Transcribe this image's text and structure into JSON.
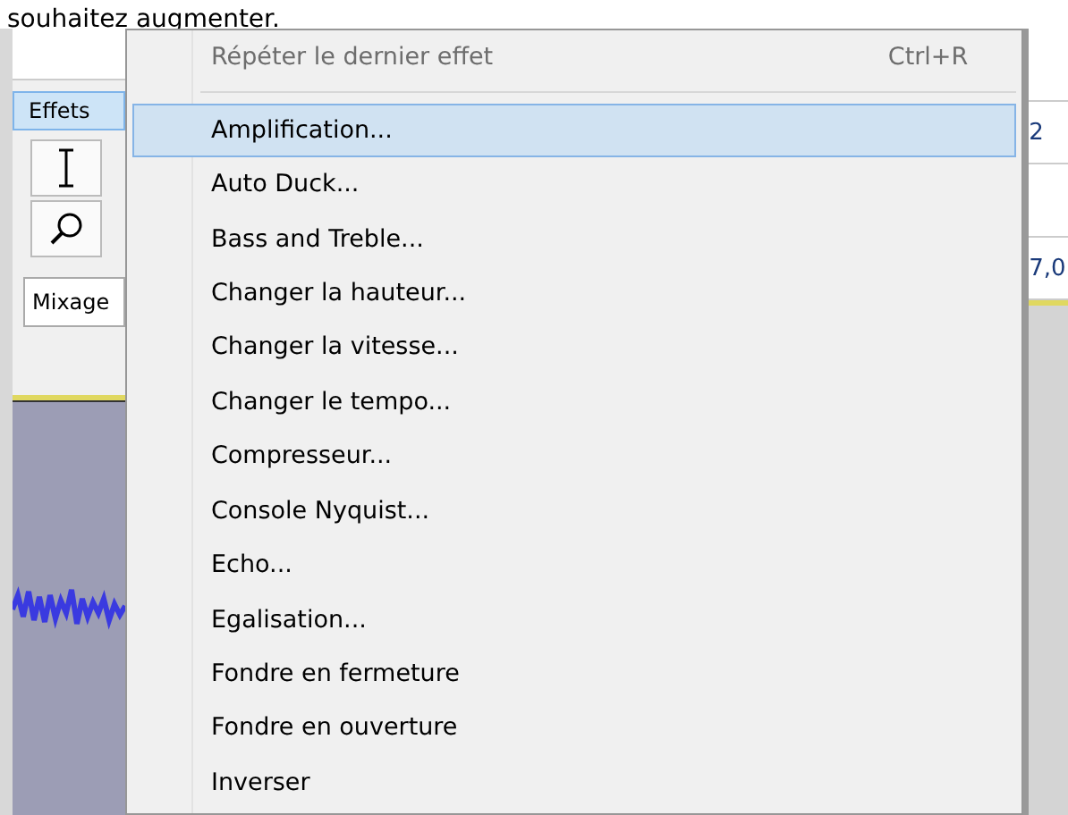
{
  "header_text": "souhaitez augmenter.",
  "app": {
    "menu_label": "Effets",
    "menu_open": true,
    "mix_dropdown": "Mixage",
    "right_labels": [
      "2",
      "7,0"
    ]
  },
  "menu": {
    "items": [
      {
        "kind": "item",
        "label": "Répéter le dernier effet",
        "shortcut": "Ctrl+R",
        "disabled": true,
        "selected": false
      },
      {
        "kind": "separator"
      },
      {
        "kind": "item",
        "label": "Amplification...",
        "disabled": false,
        "selected": true
      },
      {
        "kind": "item",
        "label": "Auto Duck...",
        "disabled": false,
        "selected": false
      },
      {
        "kind": "item",
        "label": "Bass and Treble...",
        "disabled": false,
        "selected": false
      },
      {
        "kind": "item",
        "label": "Changer la hauteur...",
        "disabled": false,
        "selected": false
      },
      {
        "kind": "item",
        "label": "Changer la vitesse...",
        "disabled": false,
        "selected": false
      },
      {
        "kind": "item",
        "label": "Changer le tempo...",
        "disabled": false,
        "selected": false
      },
      {
        "kind": "item",
        "label": "Compresseur...",
        "disabled": false,
        "selected": false
      },
      {
        "kind": "item",
        "label": "Console Nyquist...",
        "disabled": false,
        "selected": false
      },
      {
        "kind": "item",
        "label": "Echo...",
        "disabled": false,
        "selected": false
      },
      {
        "kind": "item",
        "label": "Egalisation...",
        "disabled": false,
        "selected": false
      },
      {
        "kind": "item",
        "label": "Fondre en fermeture",
        "disabled": false,
        "selected": false
      },
      {
        "kind": "item",
        "label": "Fondre en ouverture",
        "disabled": false,
        "selected": false
      },
      {
        "kind": "item",
        "label": "Inverser",
        "disabled": false,
        "selected": false
      }
    ]
  }
}
